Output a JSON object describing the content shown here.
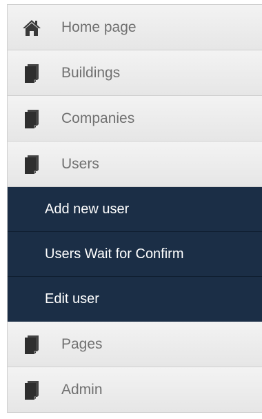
{
  "menu": {
    "items": [
      {
        "label": "Home page",
        "icon": "home-icon"
      },
      {
        "label": "Buildings",
        "icon": "document-icon"
      },
      {
        "label": "Companies",
        "icon": "document-icon"
      },
      {
        "label": "Users",
        "icon": "document-icon"
      }
    ],
    "submenu": [
      {
        "label": "Add new user"
      },
      {
        "label": "Users Wait for Confirm"
      },
      {
        "label": "Edit user"
      }
    ],
    "items_after": [
      {
        "label": "Pages",
        "icon": "document-icon"
      },
      {
        "label": "Admin",
        "icon": "document-icon"
      }
    ]
  },
  "colors": {
    "item_bg": "#ececec",
    "item_text": "#707070",
    "submenu_bg": "#1b2e46",
    "submenu_text": "#ffffff",
    "icon": "#3a3a3a"
  }
}
